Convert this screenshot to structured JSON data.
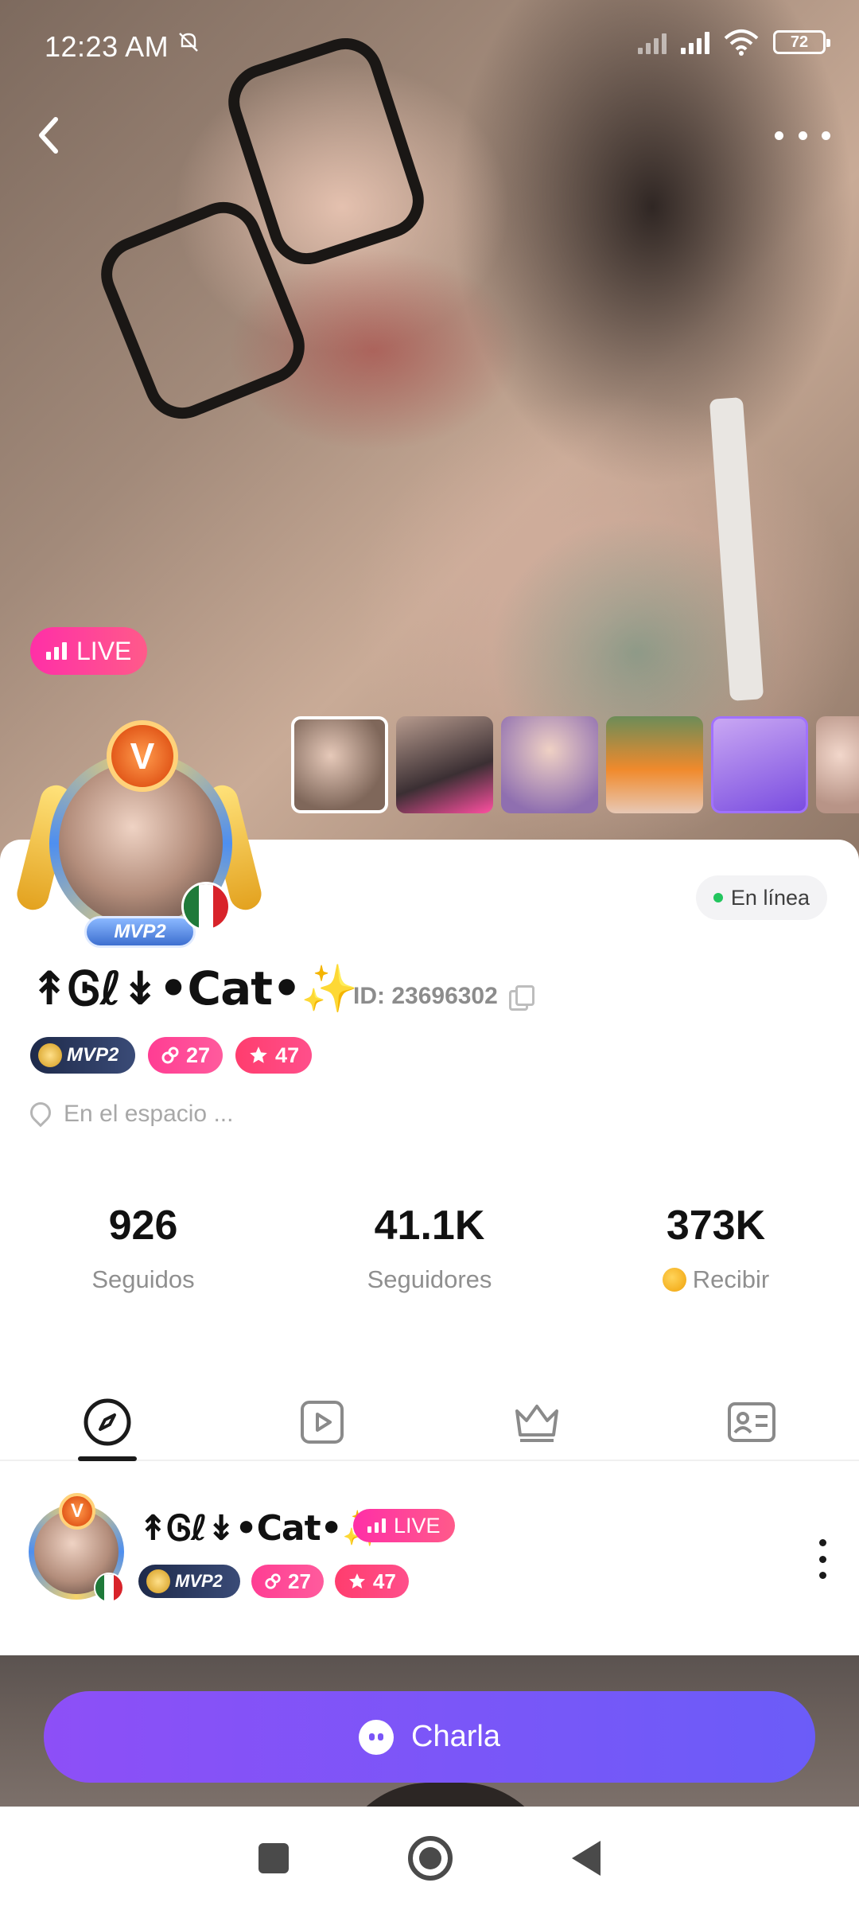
{
  "status_bar": {
    "time": "12:23 AM",
    "battery": "72",
    "icons": [
      "dnd-off-icon",
      "signal-off-icon",
      "signal-icon",
      "wifi-icon",
      "battery-icon"
    ]
  },
  "header": {
    "back_icon": "chevron-left-icon",
    "more_icon": "more-horizontal-icon"
  },
  "hero": {
    "live_label": "LIVE",
    "thumbnail_count": 6,
    "selected_thumbnail": 1
  },
  "profile": {
    "avatar_level": "V",
    "avatar_rank": "MVP2",
    "country_flag": "mexico-flag",
    "online_status": "En línea",
    "name": "↟Ꮆℓ↡•Cat•✨",
    "id_label": "ID: 23696302",
    "badges": {
      "rank": "MVP2",
      "level_a": "27",
      "level_b": "47"
    },
    "location": "En el espacio ..."
  },
  "stats": [
    {
      "value": "926",
      "label": "Seguidos"
    },
    {
      "value": "41.1K",
      "label": "Seguidores"
    },
    {
      "value": "373K",
      "label": "Recibir"
    }
  ],
  "tabs": [
    {
      "icon": "compass-icon",
      "active": true
    },
    {
      "icon": "video-play-icon",
      "active": false
    },
    {
      "icon": "crown-icon",
      "active": false
    },
    {
      "icon": "id-card-icon",
      "active": false
    }
  ],
  "feed": {
    "name": "↟Ꮆℓ↡•Cat•✨",
    "live_label": "LIVE",
    "rank": "MVP2",
    "level_a": "27",
    "level_b": "47"
  },
  "cta": {
    "label": "Charla"
  },
  "colors": {
    "accent_live": "#ff2fa7",
    "cta_start": "#8d4ff7",
    "cta_end": "#6b5cf8",
    "online_dot": "#22c55e"
  }
}
